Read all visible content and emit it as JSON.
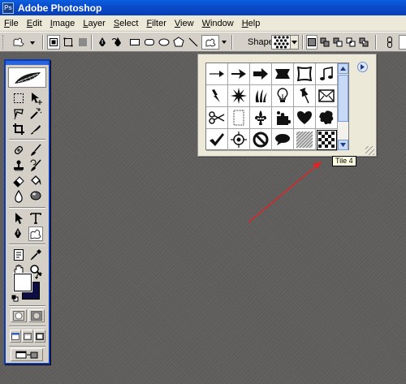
{
  "window": {
    "title": "Adobe Photoshop"
  },
  "menubar": {
    "items": [
      {
        "label": "File",
        "key": "F",
        "rest": "ile"
      },
      {
        "label": "Edit",
        "key": "E",
        "rest": "dit"
      },
      {
        "label": "Image",
        "key": "I",
        "rest": "mage"
      },
      {
        "label": "Layer",
        "key": "L",
        "rest": "ayer"
      },
      {
        "label": "Select",
        "key": "S",
        "rest": "elect"
      },
      {
        "label": "Filter",
        "key": "F",
        "rest": "ilter"
      },
      {
        "label": "View",
        "key": "V",
        "rest": "iew"
      },
      {
        "label": "Window",
        "key": "W",
        "rest": "indow"
      },
      {
        "label": "Help",
        "key": "H",
        "rest": "elp"
      }
    ]
  },
  "optionsbar": {
    "shape_label": "Shape:"
  },
  "shape_picker": {
    "icons": [
      "thin-arrow-icon",
      "arrow-icon",
      "bold-arrow-icon",
      "banner-icon",
      "frame-icon",
      "music-note-icon",
      "lightning-icon",
      "starburst-icon",
      "grass-icon",
      "lightbulb-icon",
      "push-pin-icon",
      "envelope-icon",
      "scissors-icon",
      "paper-icon",
      "fleur-de-lis-icon",
      "puzzle-icon",
      "heart-icon",
      "blob-icon",
      "checkmark-icon",
      "target-icon",
      "no-symbol-icon",
      "speech-bubble-icon",
      "diagonal-pattern-icon",
      "tile-4-icon"
    ],
    "selected_index": 23,
    "tooltip": "Tile 4"
  },
  "colors": {
    "titlebar": "#0a4ac9",
    "foreground": "#ffffff",
    "background": "#0d0d40",
    "annotation_arrow": "#e52121"
  }
}
